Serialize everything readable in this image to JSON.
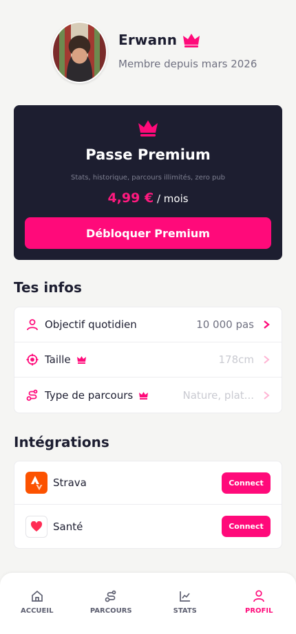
{
  "profile": {
    "name": "Erwann",
    "member_since": "Membre depuis mars 2026"
  },
  "premium": {
    "title": "Passe Premium",
    "subtitle": "Stats, historique, parcours illimités, zero pub",
    "price": "4,99 €",
    "period": "/ mois",
    "cta": "Débloquer Premium"
  },
  "infos": {
    "title": "Tes infos",
    "rows": [
      {
        "label": "Objectif quotidien",
        "value": "10 000 pas",
        "premium": false,
        "icon": "user-icon"
      },
      {
        "label": "Taille",
        "value": "178cm",
        "premium": true,
        "icon": "target-icon"
      },
      {
        "label": "Type de parcours",
        "value": "Nature,  plat...",
        "premium": true,
        "icon": "route-icon"
      }
    ]
  },
  "integrations": {
    "title": "Intégrations",
    "items": [
      {
        "name": "Strava",
        "button": "Connect",
        "icon": "strava-logo-icon"
      },
      {
        "name": "Santé",
        "button": "Connect",
        "icon": "heart-icon"
      }
    ]
  },
  "nav": {
    "items": [
      {
        "label": "ACCUEIL",
        "icon": "home-icon",
        "active": false
      },
      {
        "label": "PARCOURS",
        "icon": "route-icon",
        "active": false
      },
      {
        "label": "STATS",
        "icon": "chart-icon",
        "active": false
      },
      {
        "label": "PROFIL",
        "icon": "user-icon",
        "active": true
      }
    ]
  },
  "colors": {
    "accent": "#ff0a7a",
    "card_dark": "#1d1e30",
    "background": "#f5f5f3"
  }
}
